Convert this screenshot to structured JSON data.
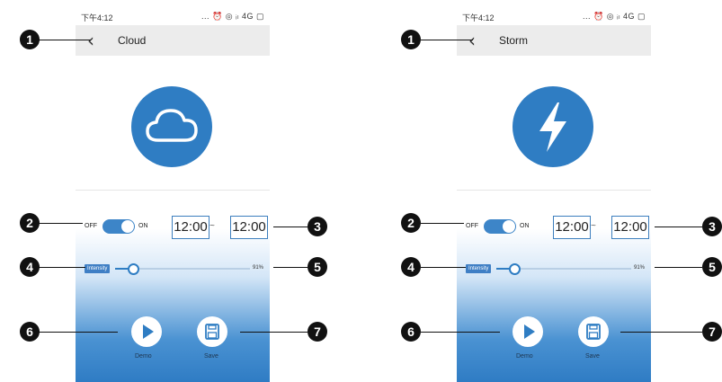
{
  "screens": [
    {
      "status_time": "下午4:12",
      "status_icons": "... ⏰ ◎ ᵢₗ 4G ▢",
      "title": "Cloud",
      "hero_icon": "cloud-icon",
      "toggle": {
        "off_label": "OFF",
        "on_label": "ON",
        "state": "on"
      },
      "start_time": "12:00",
      "time_separator": "~",
      "end_time": "12:00",
      "intensity": {
        "label": "Intensity",
        "value_text": "91%",
        "value": 91
      },
      "demo_label": "Demo",
      "save_label": "Save"
    },
    {
      "status_time": "下午4:12",
      "status_icons": "... ⏰ ◎ ᵢₗ 4G ▢",
      "title": "Storm",
      "hero_icon": "lightning-icon",
      "toggle": {
        "off_label": "OFF",
        "on_label": "ON",
        "state": "on"
      },
      "start_time": "12:00",
      "time_separator": "~",
      "end_time": "12:00",
      "intensity": {
        "label": "Intensity",
        "value_text": "91%",
        "value": 91
      },
      "demo_label": "Demo",
      "save_label": "Save"
    }
  ],
  "callouts": [
    "1",
    "2",
    "3",
    "4",
    "5",
    "6",
    "7"
  ],
  "colors": {
    "accent": "#2f7dc3",
    "nav_bar": "#ececec",
    "callout": "#111111"
  }
}
